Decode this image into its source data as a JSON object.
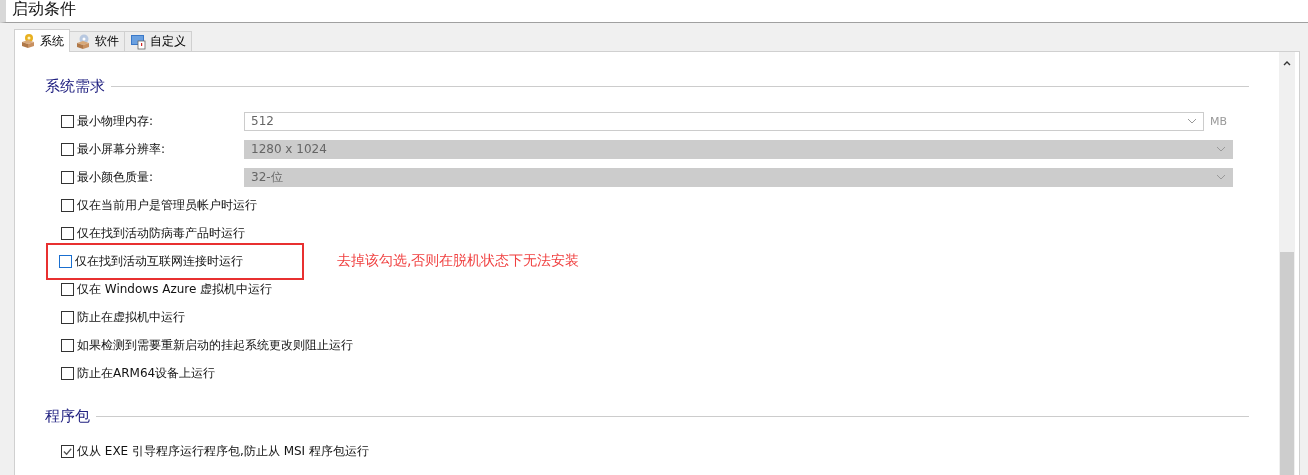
{
  "window": {
    "title": "启动条件"
  },
  "tabs": [
    {
      "label": "系统",
      "selected": true
    },
    {
      "label": "软件",
      "selected": false
    },
    {
      "label": "自定义",
      "selected": false
    }
  ],
  "sections": [
    {
      "title": "系统需求",
      "items": [
        {
          "kind": "dropdown",
          "label": "最小物理内存:",
          "checked": false,
          "value": "512",
          "disabled": false,
          "unit": "MB"
        },
        {
          "kind": "dropdown",
          "label": "最小屏幕分辨率:",
          "checked": false,
          "value": "1280 x 1024",
          "disabled": true
        },
        {
          "kind": "dropdown",
          "label": "最小颜色质量:",
          "checked": false,
          "value": "32-位",
          "disabled": true
        },
        {
          "kind": "checkbox",
          "label": "仅在当前用户是管理员帐户时运行",
          "checked": false
        },
        {
          "kind": "checkbox",
          "label": "仅在找到活动防病毒产品时运行",
          "checked": false
        },
        {
          "kind": "checkbox",
          "label": "仅在找到活动互联网连接时运行",
          "checked": false,
          "annotation": "去掉该勾选,否则在脱机状态下无法安装"
        },
        {
          "kind": "checkbox",
          "label": "仅在 Windows Azure 虚拟机中运行",
          "checked": false
        },
        {
          "kind": "checkbox",
          "label": "防止在虚拟机中运行",
          "checked": false
        },
        {
          "kind": "checkbox",
          "label": "如果检测到需要重新启动的挂起系统更改则阻止运行",
          "checked": false
        },
        {
          "kind": "checkbox",
          "label": "防止在ARM64设备上运行",
          "checked": false
        }
      ]
    },
    {
      "title": "程序包",
      "items": [
        {
          "kind": "checkbox",
          "label": "仅从 EXE 引导程序运行程序包,防止从 MSI 程序包运行",
          "checked": true
        }
      ]
    }
  ]
}
